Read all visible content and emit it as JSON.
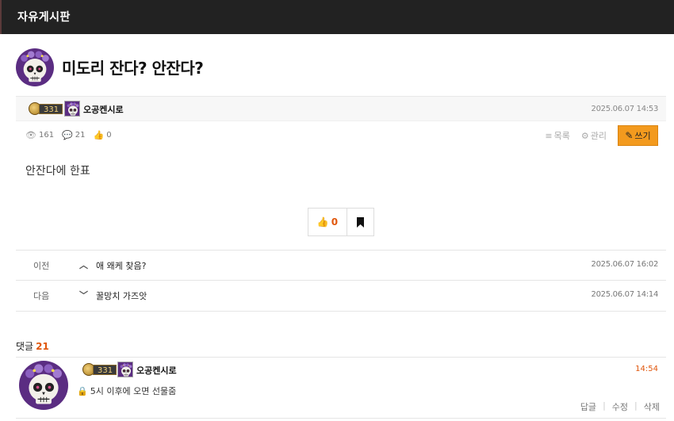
{
  "header": {
    "board_title": "자유게시판"
  },
  "post": {
    "title": "미도리 잔다? 안잔다?",
    "author": {
      "level": "331",
      "name": "오공켄시로"
    },
    "date": "2025.06.07 14:53",
    "views": "161",
    "comments": "21",
    "likes": "0",
    "body": "안잔다에 한표",
    "vote_count": "0"
  },
  "tools": {
    "list_label": "목록",
    "manage_label": "관리",
    "write_label": "쓰기"
  },
  "nav": {
    "prev": {
      "label": "이전",
      "title": "애 왜케 찾음?",
      "date": "2025.06.07 16:02"
    },
    "next": {
      "label": "다음",
      "title": "꿀망치 가즈앗",
      "date": "2025.06.07 14:14"
    }
  },
  "comments_section": {
    "label": "댓글",
    "count": "21"
  },
  "comment": {
    "level": "331",
    "author": "오공켄시로",
    "time": "14:54",
    "text": "5시 이후에 오면 선물줌",
    "actions": {
      "reply": "답글",
      "edit": "수정",
      "delete": "삭제"
    }
  },
  "colors": {
    "accent": "#f39a1e",
    "highlight": "#e0570d",
    "topbar": "#222222"
  },
  "icons": [
    "eye-icon",
    "comment-icon",
    "thumbs-up-icon",
    "list-icon",
    "gear-icon",
    "pencil-icon",
    "bookmark-icon",
    "chevron-up-icon",
    "chevron-down-icon",
    "lock-icon"
  ]
}
